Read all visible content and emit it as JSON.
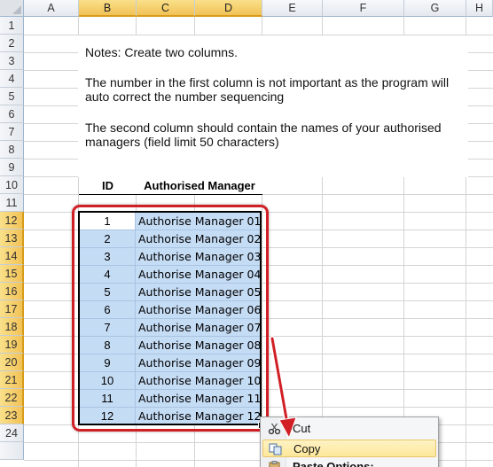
{
  "columns": [
    "A",
    "B",
    "C",
    "D",
    "E",
    "F",
    "G",
    "H"
  ],
  "rows": [
    "1",
    "2",
    "3",
    "4",
    "5",
    "6",
    "7",
    "8",
    "9",
    "10",
    "11",
    "12",
    "13",
    "14",
    "15",
    "16",
    "17",
    "18",
    "19",
    "20",
    "21",
    "22",
    "23",
    "24"
  ],
  "notes": {
    "line1": "Notes: Create two columns.",
    "line2": "The number in the first column is not important as the program will",
    "line3": "auto correct the number sequencing",
    "line4": "The second column should contain the names of your authorised",
    "line5": "managers (field limit 50 characters)"
  },
  "table": {
    "header_id": "ID",
    "header_name": "Authorised Manager",
    "rows": [
      {
        "id": "1",
        "name": "Authorise Manager 01"
      },
      {
        "id": "2",
        "name": "Authorise Manager 02"
      },
      {
        "id": "3",
        "name": "Authorise Manager 03"
      },
      {
        "id": "4",
        "name": "Authorise Manager 04"
      },
      {
        "id": "5",
        "name": "Authorise Manager 05"
      },
      {
        "id": "6",
        "name": "Authorise Manager 06"
      },
      {
        "id": "7",
        "name": "Authorise Manager 07"
      },
      {
        "id": "8",
        "name": "Authorise Manager 08"
      },
      {
        "id": "9",
        "name": "Authorise Manager 09"
      },
      {
        "id": "10",
        "name": "Authorise Manager 10"
      },
      {
        "id": "11",
        "name": "Authorise Manager 11"
      },
      {
        "id": "12",
        "name": "Authorise Manager 12"
      }
    ]
  },
  "context_menu": {
    "items": [
      {
        "label": "Cut",
        "icon": "scissors-icon"
      },
      {
        "label": "Copy",
        "icon": "copy-icon"
      },
      {
        "label": "Paste Options:",
        "icon": "paste-icon"
      }
    ]
  },
  "colors": {
    "selection_fill": "#c5dcf5",
    "highlight_header": "#f2c256",
    "annotation_red": "#d11f26"
  }
}
